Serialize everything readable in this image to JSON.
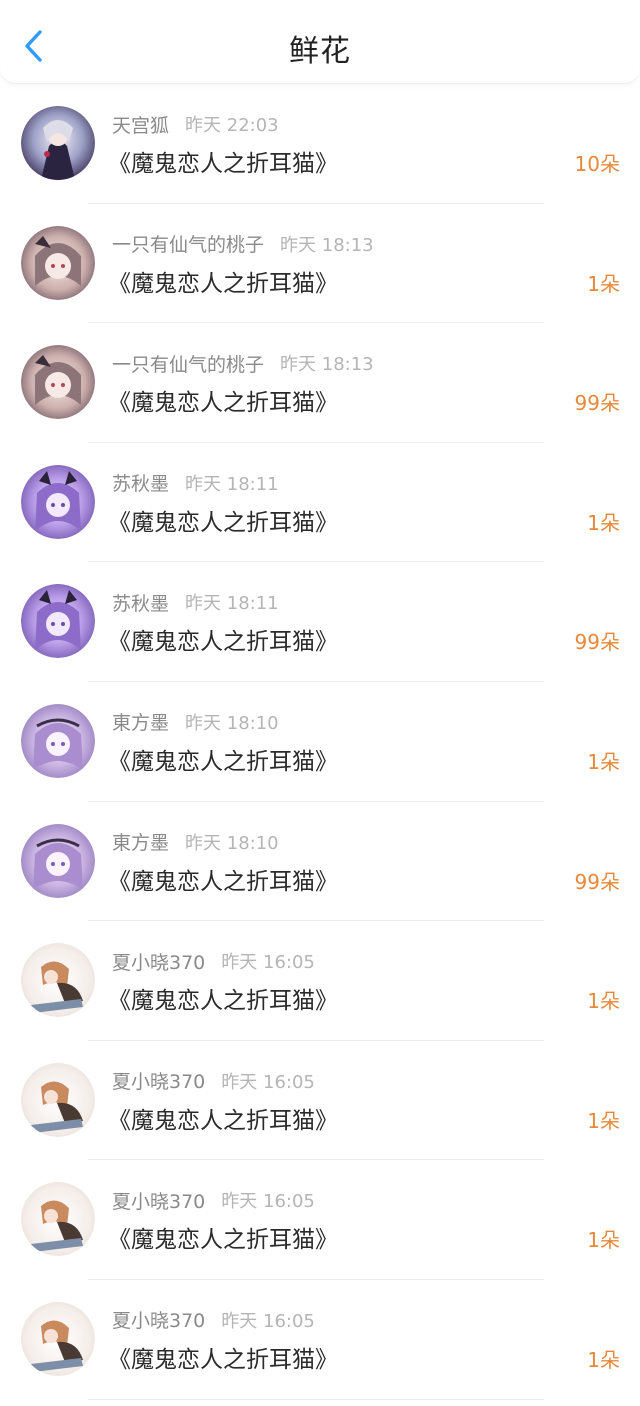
{
  "header": {
    "title": "鲜花",
    "back_icon": "chevron-left-icon",
    "accent_color": "#2f9bff"
  },
  "amount_color": "#e8883a",
  "items": [
    {
      "user": "天宫狐",
      "time": "昨天 22:03",
      "book": "《魔鬼恋人之折耳猫》",
      "amount": "10朵",
      "avatar": "avatar-a"
    },
    {
      "user": "一只有仙气的桃子",
      "time": "昨天 18:13",
      "book": "《魔鬼恋人之折耳猫》",
      "amount": "1朵",
      "avatar": "avatar-b"
    },
    {
      "user": "一只有仙气的桃子",
      "time": "昨天 18:13",
      "book": "《魔鬼恋人之折耳猫》",
      "amount": "99朵",
      "avatar": "avatar-b"
    },
    {
      "user": "苏秋墨",
      "time": "昨天 18:11",
      "book": "《魔鬼恋人之折耳猫》",
      "amount": "1朵",
      "avatar": "avatar-c"
    },
    {
      "user": "苏秋墨",
      "time": "昨天 18:11",
      "book": "《魔鬼恋人之折耳猫》",
      "amount": "99朵",
      "avatar": "avatar-c"
    },
    {
      "user": "東方墨",
      "time": "昨天 18:10",
      "book": "《魔鬼恋人之折耳猫》",
      "amount": "1朵",
      "avatar": "avatar-d"
    },
    {
      "user": "東方墨",
      "time": "昨天 18:10",
      "book": "《魔鬼恋人之折耳猫》",
      "amount": "99朵",
      "avatar": "avatar-d"
    },
    {
      "user": "夏小晓370",
      "time": "昨天 16:05",
      "book": "《魔鬼恋人之折耳猫》",
      "amount": "1朵",
      "avatar": "avatar-e"
    },
    {
      "user": "夏小晓370",
      "time": "昨天 16:05",
      "book": "《魔鬼恋人之折耳猫》",
      "amount": "1朵",
      "avatar": "avatar-e"
    },
    {
      "user": "夏小晓370",
      "time": "昨天 16:05",
      "book": "《魔鬼恋人之折耳猫》",
      "amount": "1朵",
      "avatar": "avatar-e"
    },
    {
      "user": "夏小晓370",
      "time": "昨天 16:05",
      "book": "《魔鬼恋人之折耳猫》",
      "amount": "1朵",
      "avatar": "avatar-e"
    }
  ]
}
